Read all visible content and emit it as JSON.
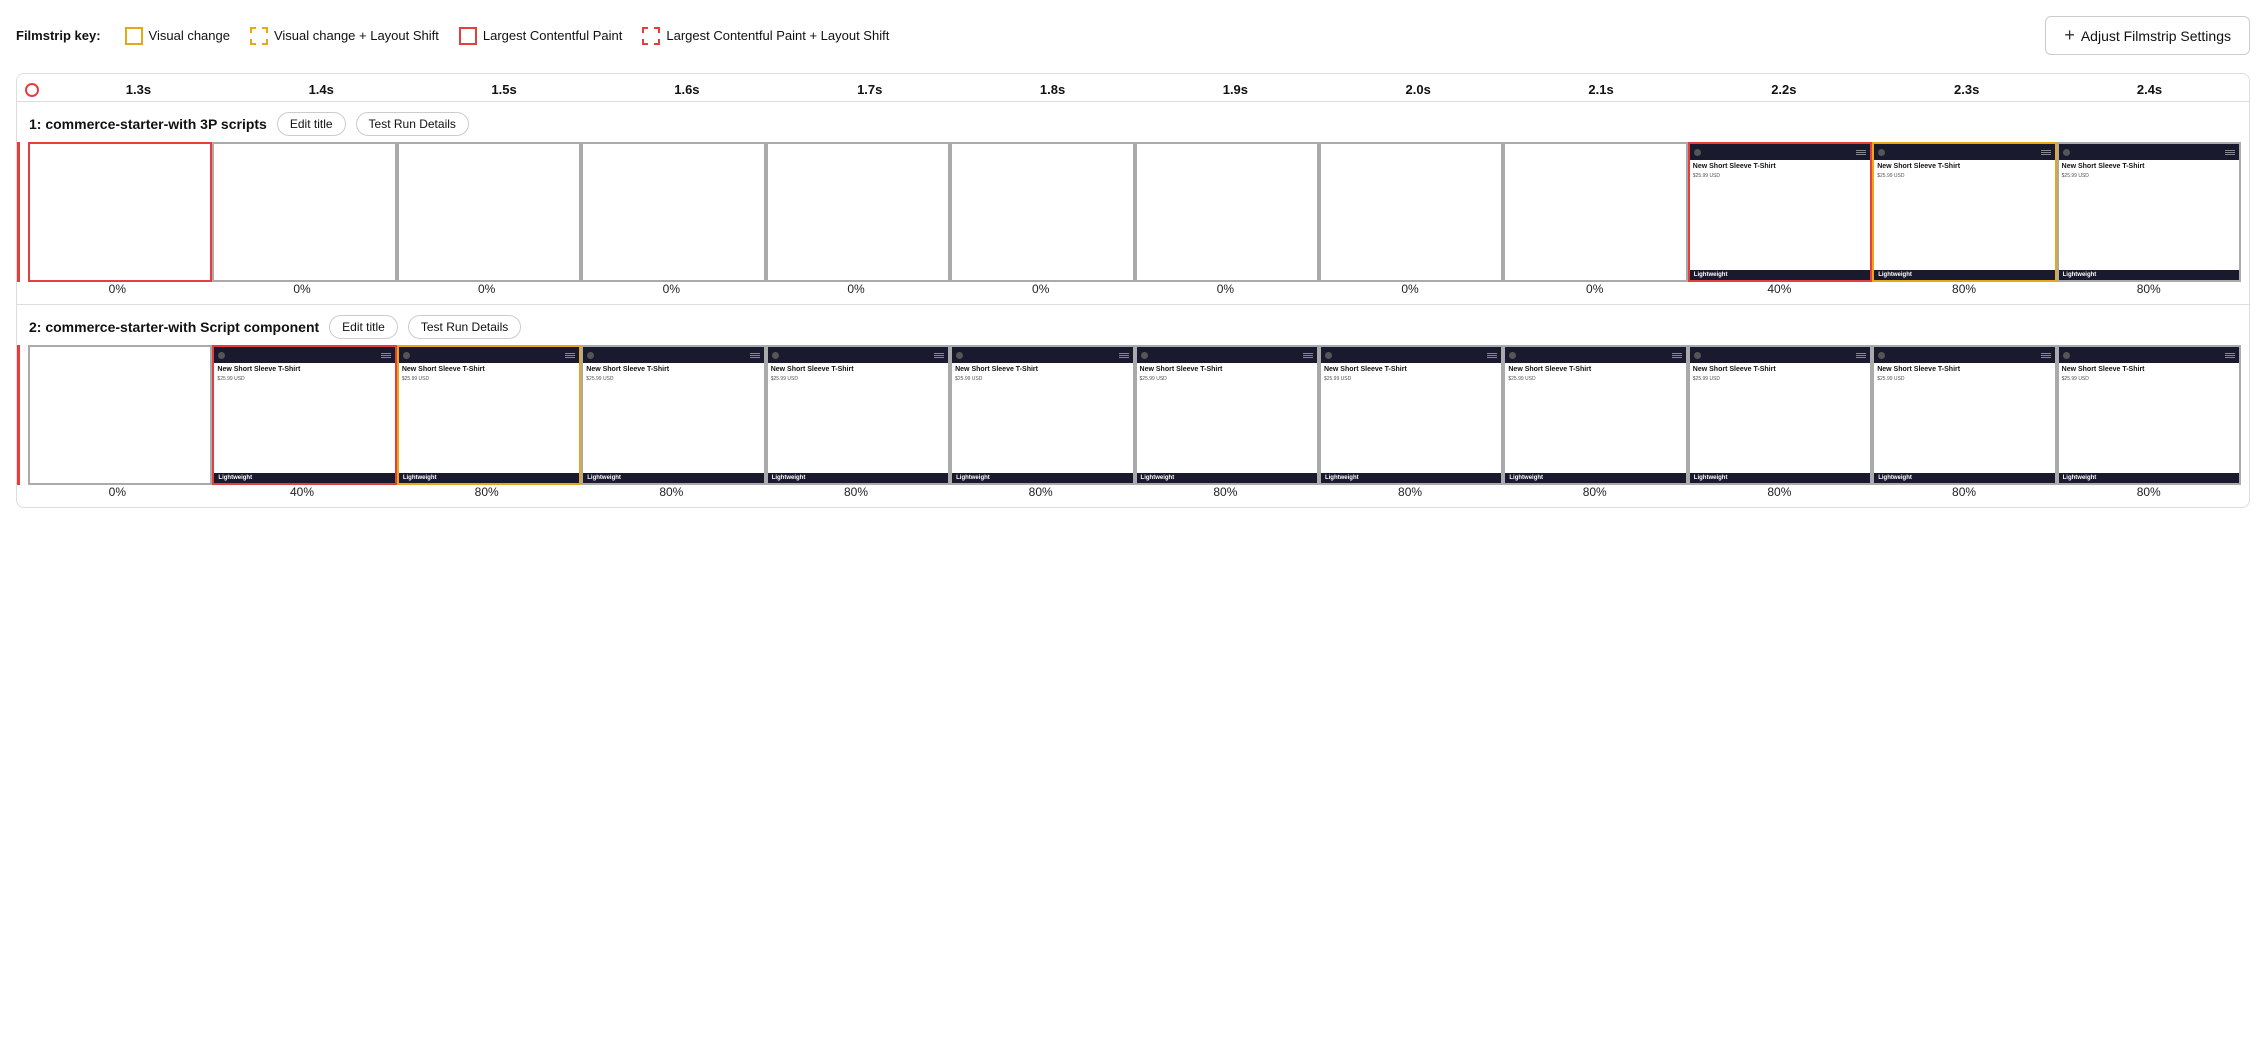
{
  "legend": {
    "prefix": "Filmstrip key:",
    "items": [
      {
        "label": "Visual change",
        "type": "solid-yellow"
      },
      {
        "label": "Visual change + Layout Shift",
        "type": "dashed-yellow"
      },
      {
        "label": "Largest Contentful Paint",
        "type": "solid-red"
      },
      {
        "label": "Largest Contentful Paint + Layout Shift",
        "type": "dashed-red"
      }
    ]
  },
  "adjustBtn": {
    "label": "Adjust Filmstrip Settings",
    "icon": "+"
  },
  "timeline": {
    "ticks": [
      "1.3s",
      "1.4s",
      "1.5s",
      "1.6s",
      "1.7s",
      "1.8s",
      "1.9s",
      "2.0s",
      "2.1s",
      "2.2s",
      "2.3s",
      "2.4s"
    ]
  },
  "rows": [
    {
      "id": "row1",
      "title": "1: commerce-starter-with 3P scripts",
      "editLabel": "Edit title",
      "detailsLabel": "Test Run Details",
      "frames": [
        {
          "type": "blank",
          "border": "red-solid",
          "percent": "0%"
        },
        {
          "type": "blank",
          "border": "none",
          "percent": "0%"
        },
        {
          "type": "blank",
          "border": "none",
          "percent": "0%"
        },
        {
          "type": "blank",
          "border": "none",
          "percent": "0%"
        },
        {
          "type": "blank",
          "border": "none",
          "percent": "0%"
        },
        {
          "type": "blank",
          "border": "none",
          "percent": "0%"
        },
        {
          "type": "blank",
          "border": "none",
          "percent": "0%"
        },
        {
          "type": "blank",
          "border": "none",
          "percent": "0%"
        },
        {
          "type": "blank",
          "border": "none",
          "percent": "0%"
        },
        {
          "type": "product",
          "border": "red-solid",
          "percent": "40%"
        },
        {
          "type": "product",
          "border": "yellow-solid",
          "percent": "80%"
        },
        {
          "type": "product",
          "border": "none",
          "percent": "80%"
        }
      ]
    },
    {
      "id": "row2",
      "title": "2: commerce-starter-with Script component",
      "editLabel": "Edit title",
      "detailsLabel": "Test Run Details",
      "frames": [
        {
          "type": "blank",
          "border": "none",
          "percent": "0%"
        },
        {
          "type": "product",
          "border": "red-solid",
          "percent": "40%"
        },
        {
          "type": "product",
          "border": "yellow-solid",
          "percent": "80%"
        },
        {
          "type": "product",
          "border": "none",
          "percent": "80%"
        },
        {
          "type": "product",
          "border": "none",
          "percent": "80%"
        },
        {
          "type": "product",
          "border": "none",
          "percent": "80%"
        },
        {
          "type": "product",
          "border": "none",
          "percent": "80%"
        },
        {
          "type": "product",
          "border": "none",
          "percent": "80%"
        },
        {
          "type": "product",
          "border": "none",
          "percent": "80%"
        },
        {
          "type": "product",
          "border": "none",
          "percent": "80%"
        },
        {
          "type": "product",
          "border": "none",
          "percent": "80%"
        },
        {
          "type": "product",
          "border": "none",
          "percent": "80%"
        }
      ]
    }
  ],
  "product": {
    "title": "New Short Sleeve T-Shirt",
    "price": "$25.99 USD",
    "footer": "Lightweight"
  }
}
